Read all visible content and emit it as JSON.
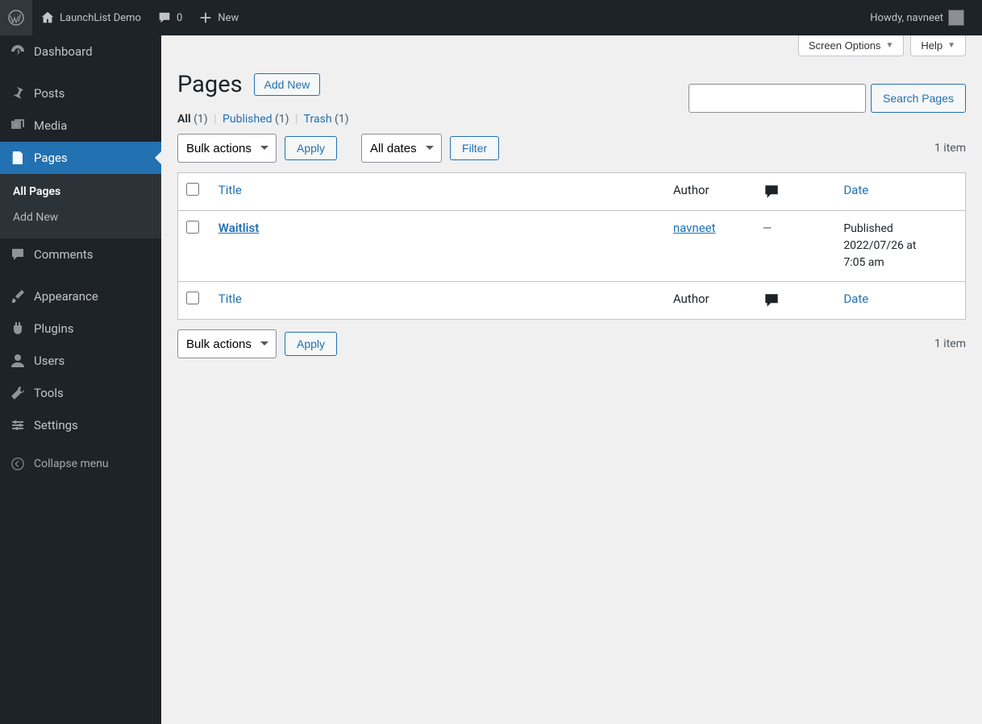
{
  "topbar": {
    "site_name": "LaunchList Demo",
    "comments_count": "0",
    "new_label": "New",
    "greeting": "Howdy, navneet"
  },
  "sidebar": {
    "items": [
      {
        "label": "Dashboard"
      },
      {
        "label": "Posts"
      },
      {
        "label": "Media"
      },
      {
        "label": "Pages"
      },
      {
        "label": "Comments"
      },
      {
        "label": "Appearance"
      },
      {
        "label": "Plugins"
      },
      {
        "label": "Users"
      },
      {
        "label": "Tools"
      },
      {
        "label": "Settings"
      }
    ],
    "submenu": {
      "all_pages": "All Pages",
      "add_new": "Add New"
    },
    "collapse": "Collapse menu"
  },
  "screen_meta": {
    "screen_options": "Screen Options",
    "help": "Help"
  },
  "heading": {
    "title": "Pages",
    "add_new": "Add New"
  },
  "filters": {
    "all_label": "All",
    "all_count": "(1)",
    "published_label": "Published",
    "published_count": "(1)",
    "trash_label": "Trash",
    "trash_count": "(1)"
  },
  "controls": {
    "bulk_actions": "Bulk actions",
    "apply": "Apply",
    "all_dates": "All dates",
    "filter": "Filter",
    "items_count": "1 item",
    "search_button": "Search Pages"
  },
  "table": {
    "headers": {
      "title": "Title",
      "author": "Author",
      "date": "Date"
    },
    "rows": [
      {
        "title": "Waitlist",
        "author": "navneet",
        "comments": "—",
        "date_status": "Published",
        "date_line2": "2022/07/26 at",
        "date_line3": "7:05 am"
      }
    ]
  }
}
